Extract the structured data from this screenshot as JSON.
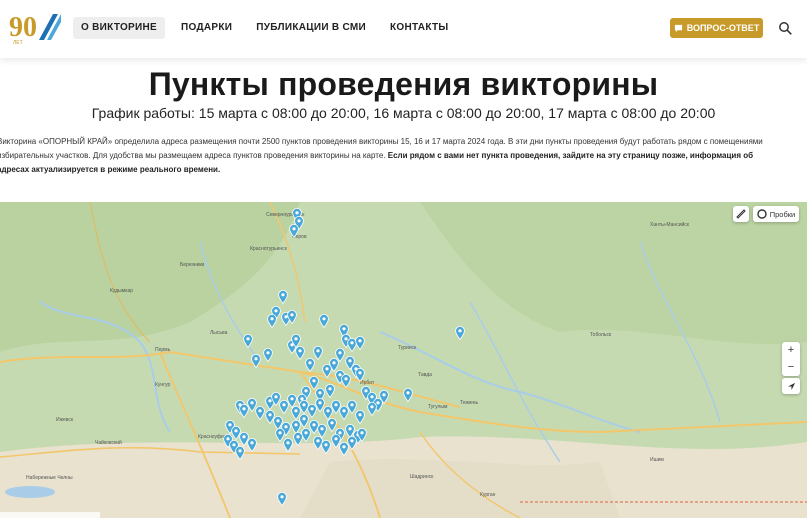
{
  "header": {
    "logo_text": "90 лет",
    "nav": [
      {
        "label": "О ВИКТОРИНЕ",
        "active": true
      },
      {
        "label": "ПОДАРКИ",
        "active": false
      },
      {
        "label": "ПУБЛИКАЦИИ В СМИ",
        "active": false
      },
      {
        "label": "КОНТАКТЫ",
        "active": false
      }
    ],
    "qa_button": "ВОПРОС-ОТВЕТ",
    "search_icon": "search-icon"
  },
  "page": {
    "title": "Пункты проведения викторины",
    "subtitle": "График работы: 15 марта с 08:00 до 20:00, 16 марта с 08:00 до 20:00, 17 марта с 08:00 до 20:00",
    "intro_plain": "Викторина «ОПОРНЫЙ КРАЙ» определила адреса размещения почти 2500 пунктов проведения викторины 15, 16 и 17 марта 2024 года. В эти дни пункты проведения будут работать рядом с помещениями избирательных участков. Для удобства мы размещаем адреса пунктов проведения викторины на карте.",
    "intro_bold": "Если рядом с вами нет пункта проведения, зайдите на эту страницу позже, информация об адресах актуализируется в режиме реального времени."
  },
  "map": {
    "traffic_label": "Пробки",
    "zoom_in": "+",
    "zoom_out": "−",
    "labels": [
      {
        "text": "Северноуральск"
      },
      {
        "text": "Краснотурьинск"
      },
      {
        "text": "Серов"
      },
      {
        "text": "Пермь"
      },
      {
        "text": "Кунгур"
      },
      {
        "text": "Тюмень"
      },
      {
        "text": "Тобольск"
      },
      {
        "text": "Ишим"
      },
      {
        "text": "Курган"
      },
      {
        "text": "Шадринск"
      },
      {
        "text": "Ижевск"
      },
      {
        "text": "Лысьва"
      },
      {
        "text": "Набережные Челны"
      },
      {
        "text": "Туринск"
      },
      {
        "text": "Тавда"
      },
      {
        "text": "Ирбит"
      },
      {
        "text": "Тугулым"
      },
      {
        "text": "Красноуфимск"
      },
      {
        "text": "Чайковский"
      },
      {
        "text": "Березники"
      },
      {
        "text": "Кудымкар"
      },
      {
        "text": "Ханты-Мансийск"
      }
    ],
    "colors": {
      "pin": "#4aa8d8",
      "land": "#c9dcb5",
      "road": "#f3c66a",
      "water": "#a9cde8"
    }
  }
}
